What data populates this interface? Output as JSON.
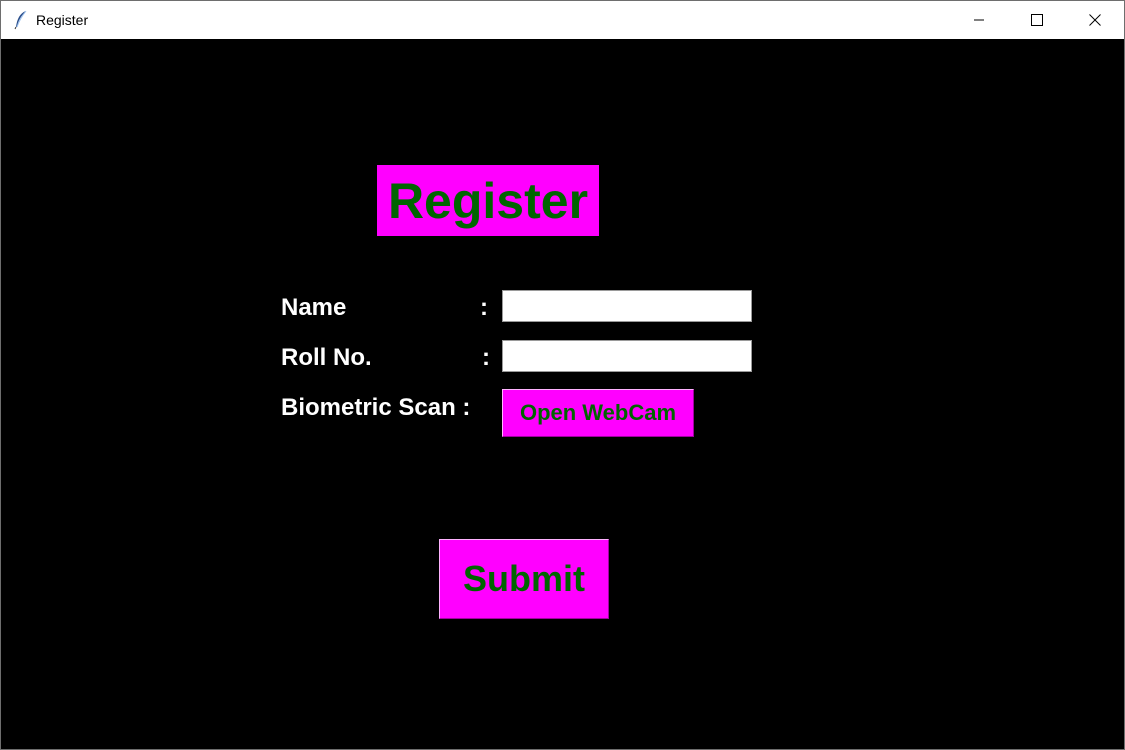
{
  "window": {
    "title": "Register",
    "app_icon": "feather-icon",
    "controls": {
      "minimize_icon": "minimize-icon",
      "maximize_icon": "maximize-icon",
      "close_icon": "close-icon"
    }
  },
  "form": {
    "heading": "Register",
    "name_label": "Name",
    "name_colon": ":",
    "name_value": "",
    "roll_label": "Roll No.",
    "roll_colon": ":",
    "roll_value": "",
    "biometric_label": "Biometric Scan :",
    "webcam_button": "Open WebCam",
    "submit_button": "Submit"
  },
  "colors": {
    "background": "#000000",
    "accent": "#ff00ff",
    "button_text": "#006400",
    "label_text": "#ffffff"
  }
}
